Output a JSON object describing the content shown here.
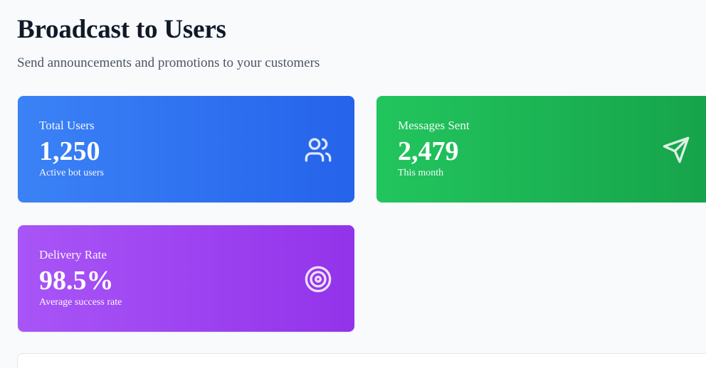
{
  "header": {
    "title": "Broadcast to Users",
    "subtitle": "Send announcements and promotions to your customers"
  },
  "stats": [
    {
      "label": "Total Users",
      "value": "1,250",
      "sub": "Active bot users",
      "icon": "users-icon",
      "color": "#3b82f6"
    },
    {
      "label": "Messages Sent",
      "value": "2,479",
      "sub": "This month",
      "icon": "send-icon",
      "color": "#22c55e"
    },
    {
      "label": "Delivery Rate",
      "value": "98.5%",
      "sub": "Average success rate",
      "icon": "target-icon",
      "color": "#a855f7"
    }
  ]
}
